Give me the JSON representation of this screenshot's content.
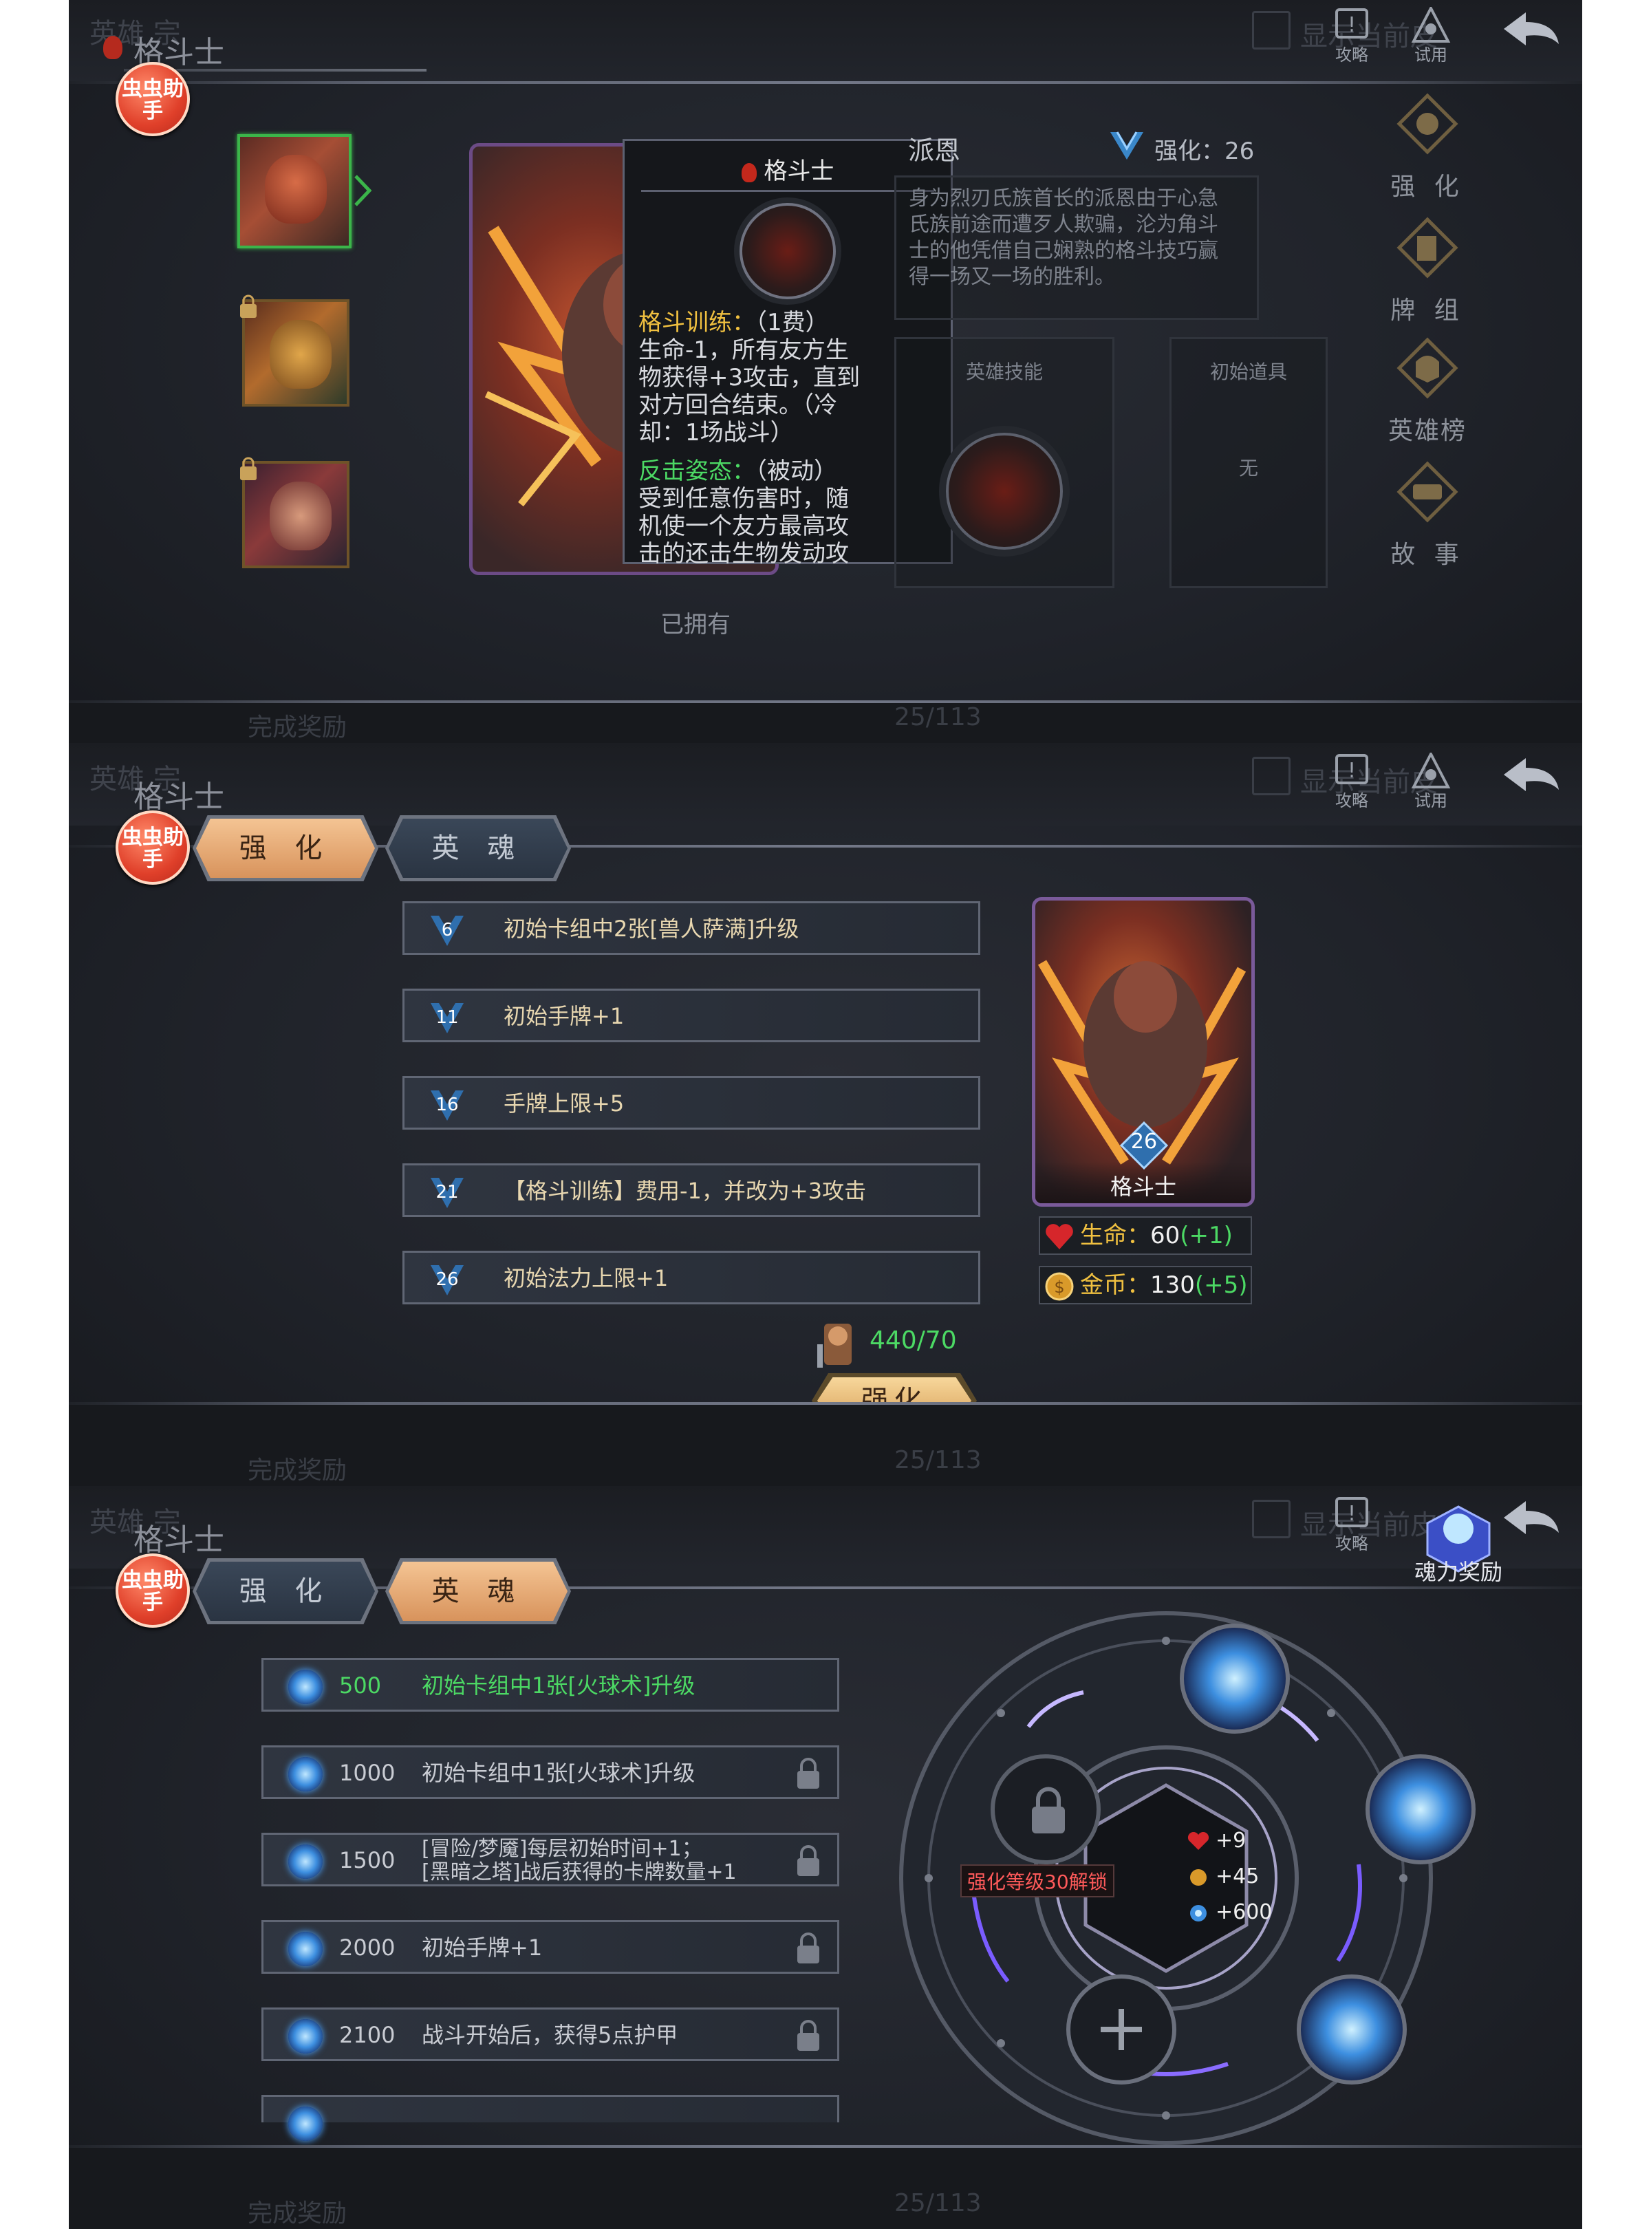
{
  "common": {
    "header_ghost": "英雄  宗",
    "title": "格斗士",
    "helper_label": "虫虫助手",
    "guide_label": "攻略",
    "trial_label": "试用",
    "checkbox_ghost": "显示当前皮",
    "bottom_left_ghost": "完成奖励",
    "bottom_page": "25/113",
    "colors": {
      "accent": "#f0c040",
      "green": "#4cd964",
      "helper_red": "#e0402a"
    }
  },
  "panel1": {
    "tooltip": {
      "title": "格斗士",
      "skill1_name": "格斗训练：",
      "skill1_cost": "（1费）",
      "skill1_lines": [
        "生命-1，所有友方生",
        "物获得+3攻击，直到",
        "对方回合结束。（冷",
        "却：1场战斗）"
      ],
      "skill2_name": "反击姿态：",
      "skill2_type": "（被动）",
      "skill2_lines": [
        "受到任意伤害时，随",
        "机使一个友方最高攻",
        "击的还击生物发动攻"
      ]
    },
    "owned_label": "已拥有",
    "hero_name": "派恩",
    "enhance_label": "强化：26",
    "description_lines": [
      "身为烈刃氏族首长的派恩由于心急",
      "氏族前途而遭歹人欺骗，沦为角斗",
      "士的他凭借自己娴熟的格斗技巧赢",
      "得一场又一场的胜利。"
    ],
    "hero_skill_label": "英雄技能",
    "initial_item_label": "初始道具",
    "initial_item_value": "无",
    "side_menu": [
      "强 化",
      "牌 组",
      "英雄榜",
      "故 事"
    ]
  },
  "panel2": {
    "tabs": [
      "强 化",
      "英 魂"
    ],
    "upgrades": [
      {
        "level": "6",
        "text": "初始卡组中2张[兽人萨满]升级"
      },
      {
        "level": "11",
        "text": "初始手牌+1"
      },
      {
        "level": "16",
        "text": "手牌上限+5"
      },
      {
        "level": "21",
        "text": "【格斗训练】费用-1，并改为+3攻击"
      },
      {
        "level": "26",
        "text": "初始法力上限+1"
      }
    ],
    "card_level": "26",
    "card_name": "格斗士",
    "life_label": "生命：",
    "life_value": "60",
    "life_bonus": "(+1)",
    "gold_label": "金币：",
    "gold_value": "130",
    "gold_bonus": "(+5)",
    "resource": "440/70",
    "enhance_button": "强化"
  },
  "panel3": {
    "tabs": [
      "强 化",
      "英 魂"
    ],
    "reward_label": "魂力奖励",
    "soul_upgrades": [
      {
        "cost": "500",
        "text": "初始卡组中1张[火球术]升级",
        "unlocked": true
      },
      {
        "cost": "1000",
        "text": "初始卡组中1张[火球术]升级",
        "unlocked": false
      },
      {
        "cost": "1500",
        "text": "[冒险/梦魇]每层初始时间+1；",
        "text2": "[黑暗之塔]战后获得的卡牌数量+1",
        "unlocked": false
      },
      {
        "cost": "2000",
        "text": "初始手牌+1",
        "unlocked": false
      },
      {
        "cost": "2100",
        "text": "战斗开始后，获得5点护甲",
        "unlocked": false
      }
    ],
    "unlock_hint": "强化等级30解锁",
    "center_stats": [
      "+9",
      "+45",
      "+600"
    ]
  }
}
